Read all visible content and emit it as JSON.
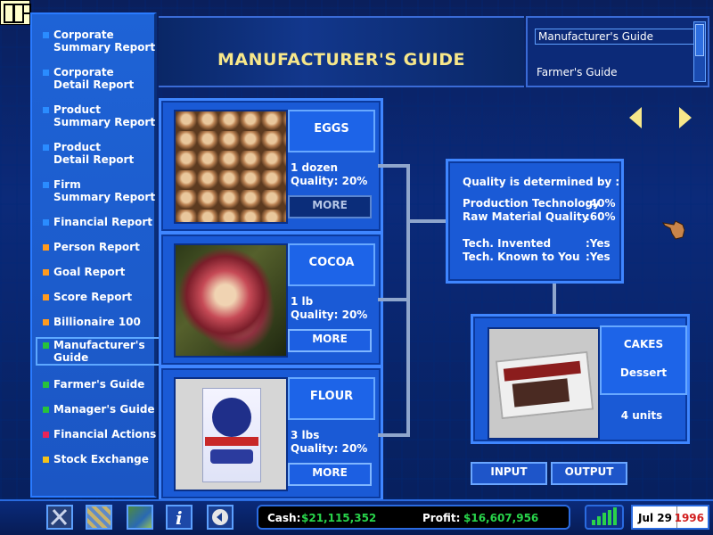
{
  "menu": {
    "items": [
      {
        "label1": "Corporate",
        "label2": "Summary Report",
        "color": "#2a8cff"
      },
      {
        "label1": "Corporate",
        "label2": "Detail Report",
        "color": "#2a8cff"
      },
      {
        "label1": "Product",
        "label2": "Summary Report",
        "color": "#2a8cff"
      },
      {
        "label1": "Product",
        "label2": "Detail Report",
        "color": "#2a8cff"
      },
      {
        "label1": "Firm",
        "label2": "Summary Report",
        "color": "#2a8cff"
      },
      {
        "label1": "Financial Report",
        "label2": "",
        "color": "#2a8cff"
      },
      {
        "label1": "Person Report",
        "label2": "",
        "color": "#ff9a1f"
      },
      {
        "label1": "Goal Report",
        "label2": "",
        "color": "#ff9a1f"
      },
      {
        "label1": "Score Report",
        "label2": "",
        "color": "#ff9a1f"
      },
      {
        "label1": "Billionaire 100",
        "label2": "",
        "color": "#ff9a1f"
      },
      {
        "label1": "Manufacturer's",
        "label2": "Guide",
        "color": "#27c23c",
        "selected": true
      },
      {
        "label1": "Farmer's Guide",
        "label2": "",
        "color": "#27c23c"
      },
      {
        "label1": "Manager's Guide",
        "label2": "",
        "color": "#27c23c"
      },
      {
        "label1": "Financial Actions",
        "label2": "",
        "color": "#e8245a"
      },
      {
        "label1": "Stock Exchange",
        "label2": "",
        "color": "#f2c21a"
      }
    ]
  },
  "header": {
    "title": "MANUFACTURER'S GUIDE"
  },
  "guides": {
    "selected": "Manufacturer's Guide",
    "other": "Farmer's Guide"
  },
  "ingredients": [
    {
      "name": "EGGS",
      "qty": "1 dozen",
      "quality": "Quality: 20%",
      "more": "MORE"
    },
    {
      "name": "COCOA",
      "qty": "1 lb",
      "quality": "Quality: 20%",
      "more": "MORE"
    },
    {
      "name": "FLOUR",
      "qty": "3 lbs",
      "quality": "Quality: 20%",
      "more": "MORE"
    }
  ],
  "quality_box": {
    "heading": "Quality is determined by :",
    "rows": [
      {
        "k": "Production Technology",
        "v": ":40%"
      },
      {
        "k": "Raw Material Quality",
        "v": ":60%"
      },
      {
        "k": "Tech. Invented",
        "v": ":Yes"
      },
      {
        "k": "Tech. Known to You",
        "v": ":Yes"
      }
    ]
  },
  "product": {
    "name": "CAKES",
    "category": "Dessert",
    "units": "4 units"
  },
  "tabs": {
    "input": "INPUT",
    "output": "OUTPUT"
  },
  "status": {
    "cash_label": "Cash:",
    "cash_value": "$21,115,352",
    "profit_label": "Profit:",
    "profit_value": "$16,607,956",
    "date": "Jul 29",
    "year": "1996"
  },
  "toolbar_icons": [
    "tools-icon",
    "map-grid-icon",
    "world-map-icon",
    "info-icon",
    "back-icon"
  ]
}
